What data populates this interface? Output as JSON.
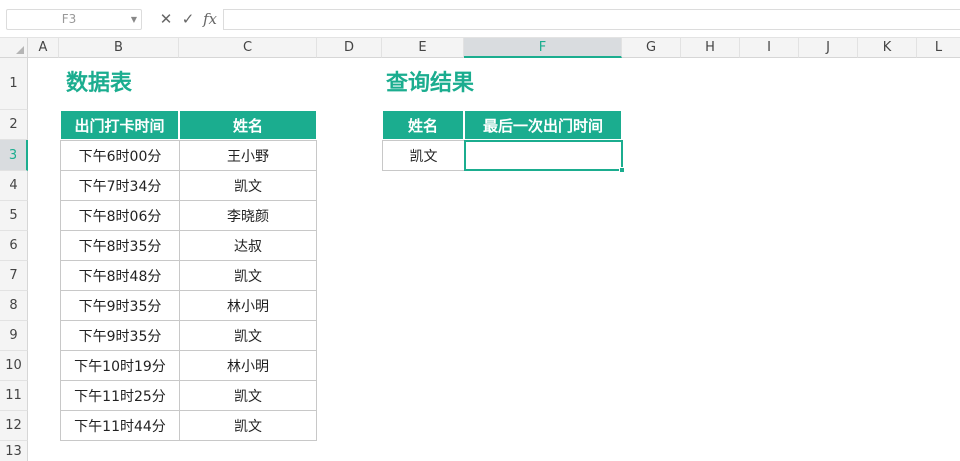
{
  "formula_bar": {
    "name_box": "F3",
    "cancel_icon": "✕",
    "enter_icon": "✓",
    "fx_label": "fx",
    "formula": ""
  },
  "columns": [
    "A",
    "B",
    "C",
    "D",
    "E",
    "F",
    "G",
    "H",
    "I",
    "J",
    "K",
    "L"
  ],
  "rows": [
    "1",
    "2",
    "3",
    "4",
    "5",
    "6",
    "7",
    "8",
    "9",
    "10",
    "11",
    "12",
    "13"
  ],
  "selected_column": "F",
  "selected_row": "3",
  "data_table": {
    "title": "数据表",
    "headers": [
      "出门打卡时间",
      "姓名"
    ],
    "rows": [
      [
        "下午6时00分",
        "王小野"
      ],
      [
        "下午7时34分",
        "凯文"
      ],
      [
        "下午8时06分",
        "李晓颜"
      ],
      [
        "下午8时35分",
        "达叔"
      ],
      [
        "下午8时48分",
        "凯文"
      ],
      [
        "下午9时35分",
        "林小明"
      ],
      [
        "下午9时35分",
        "凯文"
      ],
      [
        "下午10时19分",
        "林小明"
      ],
      [
        "下午11时25分",
        "凯文"
      ],
      [
        "下午11时44分",
        "凯文"
      ]
    ]
  },
  "query_table": {
    "title": "查询结果",
    "headers": [
      "姓名",
      "最后一次出门时间"
    ],
    "row": [
      "凯文",
      ""
    ]
  },
  "colors": {
    "accent": "#1bad8f",
    "header_bg": "#f4f4f4",
    "selected_header_bg": "#d9dcdf"
  }
}
